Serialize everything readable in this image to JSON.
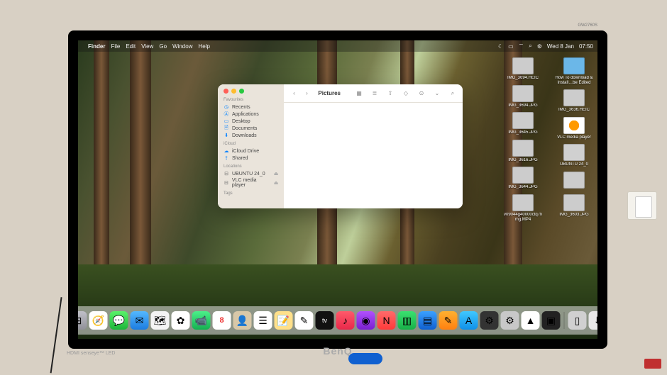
{
  "menubar": {
    "app": "Finder",
    "items": [
      "File",
      "Edit",
      "View",
      "Go",
      "Window",
      "Help"
    ],
    "right": {
      "date": "Wed 8 Jan",
      "time": "07:50"
    }
  },
  "finder": {
    "title": "Pictures",
    "sections": {
      "favourites": {
        "head": "Favourites",
        "items": [
          "Recents",
          "Applications",
          "Desktop",
          "Documents",
          "Downloads"
        ]
      },
      "icloud": {
        "head": "iCloud",
        "items": [
          "iCloud Drive",
          "Shared"
        ]
      },
      "locations": {
        "head": "Locations",
        "items": [
          "UBUNTU 24_0",
          "VLC media player"
        ]
      },
      "tags": {
        "head": "Tags"
      }
    }
  },
  "desktop": {
    "col1": [
      "IMG_3694.HEIC",
      "IMG_3694.JPG",
      "IMG_3645.JPG",
      "IMG_3616.JPG",
      "IMG_3644.JPG",
      "v09044g40000ctq7foveg…mg.MP4"
    ],
    "col2": [
      "How To download & Install…be Edited",
      "IMG_3636.HEIC",
      "VLC media player",
      "UBUNTU 24_0",
      "",
      "IMG_3603.JPG"
    ]
  },
  "dock": {
    "cal_day": "8"
  },
  "monitor": {
    "brand": "BenQ",
    "model": "GW2760S",
    "port": "HDMI senseye™ LED"
  }
}
